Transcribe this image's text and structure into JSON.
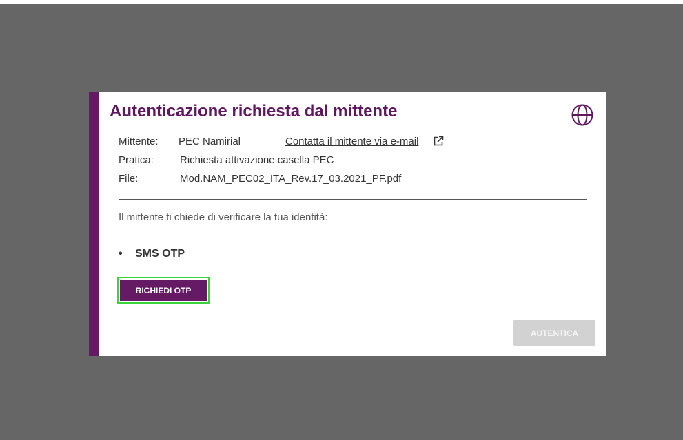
{
  "dialog": {
    "title": "Autenticazione richiesta dal mittente",
    "globe_icon": "globe-icon",
    "accent_color": "#651b64",
    "info": {
      "sender_label": "Mittente:",
      "sender_value": "PEC Namirial",
      "contact_link": "Contatta il mittente via e-mail",
      "contact_icon": "external-link-icon",
      "practice_label": "Pratica:",
      "practice_value": "Richiesta attivazione casella PEC",
      "file_label": "File:",
      "file_value": "Mod.NAM_PEC02_ITA_Rev.17_03.2021_PF.pdf"
    },
    "prompt": "Il mittente ti chiede di verificare la tua identità:",
    "method": {
      "bullet": "•",
      "label": "SMS OTP"
    },
    "request_otp_button": "RICHIEDI OTP",
    "authenticate_button": "AUTENTICA",
    "authenticate_enabled": false,
    "focus_ring_color": "#3bd33b"
  }
}
